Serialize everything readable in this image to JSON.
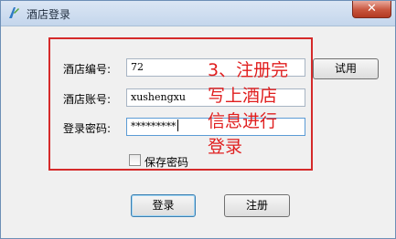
{
  "window": {
    "title": "酒店登录",
    "close_glyph": "✕"
  },
  "form": {
    "hotel_id_label": "酒店编号:",
    "hotel_id_value": "72",
    "account_label": "酒店账号:",
    "account_value": "xushengxu",
    "password_label": "登录密码:",
    "password_value": "*********",
    "test_button": "试用",
    "remember_label": "保存密码",
    "remember_checked": false
  },
  "actions": {
    "login": "登录",
    "register": "注册"
  },
  "annotation": {
    "lines": [
      "3、注册完",
      "写上酒店",
      "信息进行",
      "登录"
    ],
    "color": "#e01e1e"
  },
  "colors": {
    "highlight_box": "#d52a2a"
  }
}
